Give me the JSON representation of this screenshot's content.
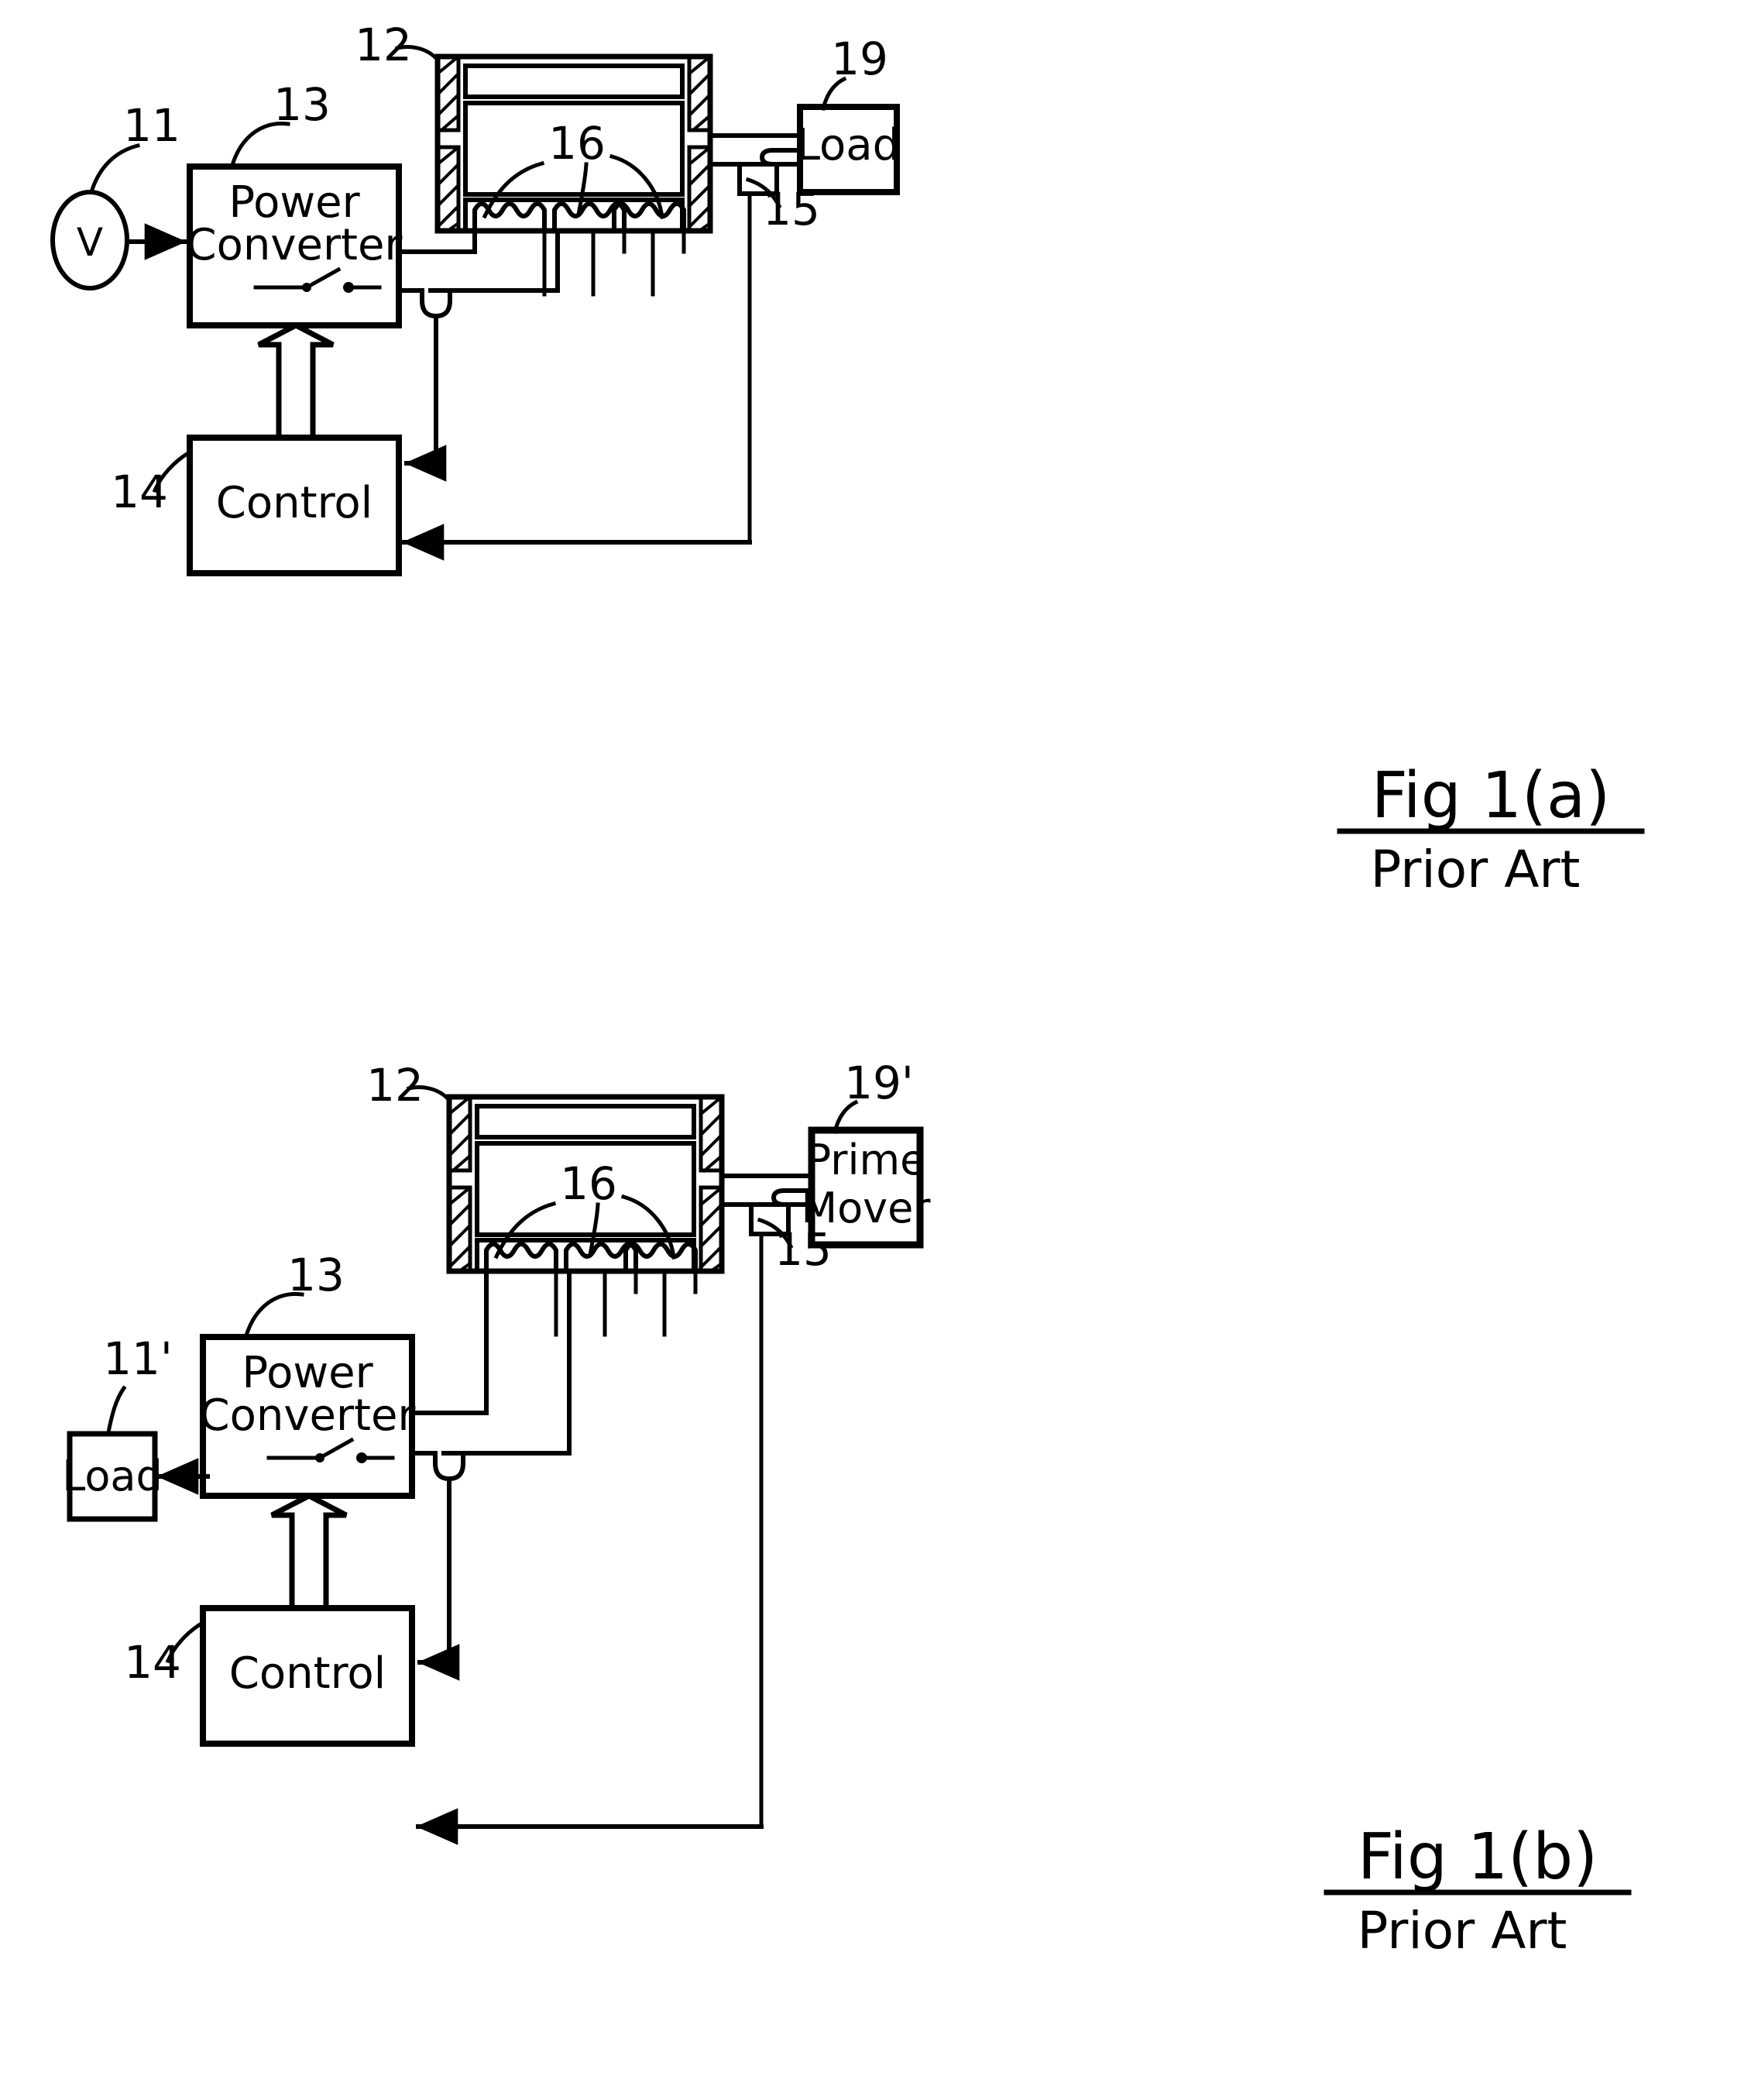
{
  "figures": [
    {
      "id": "fig-a",
      "caption": "Fig 1(a)",
      "subcaption": "Prior Art",
      "blocks": {
        "source_symbol": "V",
        "source_ref": "11",
        "power_converter": "Power\nConverter",
        "power_converter_line1": "Power",
        "power_converter_line2": "Converter",
        "power_converter_ref": "13",
        "control": "Control",
        "control_ref": "14",
        "machine_ref": "12",
        "windings_ref": "16",
        "sensor_ref": "15",
        "right_box_line1": "Load",
        "right_box_line2": "",
        "right_box_ref": "19"
      }
    },
    {
      "id": "fig-b",
      "caption": "Fig 1(b)",
      "subcaption": "Prior Art",
      "blocks": {
        "left_box_label": "Load",
        "left_box_ref": "11'",
        "power_converter_line1": "Power",
        "power_converter_line2": "Converter",
        "power_converter_ref": "13",
        "control": "Control",
        "control_ref": "14",
        "machine_ref": "12",
        "windings_ref": "16",
        "sensor_ref": "15",
        "right_box_line1": "Prime",
        "right_box_line2": "Mover",
        "right_box_ref": "19'"
      }
    }
  ],
  "colors": {
    "ink": "#000000",
    "paper": "#ffffff"
  }
}
